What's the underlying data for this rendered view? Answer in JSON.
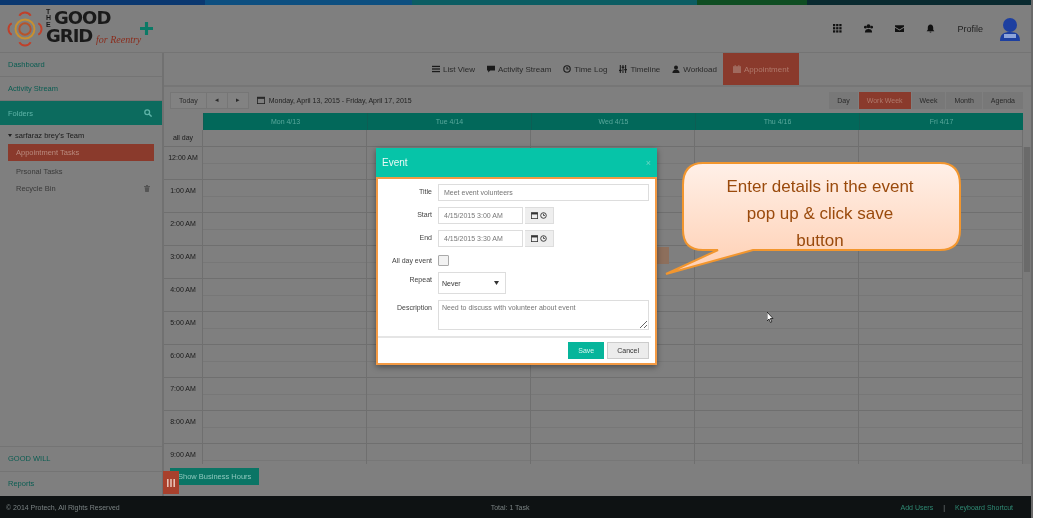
{
  "logo": {
    "small": "THE",
    "line1": "GOOD",
    "line2": "GRID",
    "tagline": "for Reentry"
  },
  "header": {
    "icons": [
      {
        "kind": "grid"
      },
      {
        "kind": "users"
      },
      {
        "kind": "mail"
      },
      {
        "kind": "bell"
      }
    ],
    "profile": "Profile"
  },
  "sidebar": {
    "top_items": [
      "Dashboard",
      "Activity Stream"
    ],
    "folders": {
      "label": "Folders"
    },
    "team": {
      "label": "sarfaraz brey's Team",
      "expanded": true,
      "children": [
        {
          "label": "Appointment Tasks",
          "selected": true,
          "trash": false
        },
        {
          "label": "Prsonal Tasks",
          "selected": false,
          "trash": false
        },
        {
          "label": "Recycle Bin",
          "selected": false,
          "trash": true
        }
      ]
    },
    "bottom_items": [
      "GOOD WILL",
      "Reports"
    ]
  },
  "nav_tabs": [
    {
      "label": "List View",
      "kind": "list",
      "selected": false
    },
    {
      "label": "Activity Stream",
      "kind": "comment",
      "selected": false
    },
    {
      "label": "Time Log",
      "kind": "clock",
      "selected": false
    },
    {
      "label": "Timeline",
      "kind": "sliders",
      "selected": false
    },
    {
      "label": "Workload",
      "kind": "user",
      "selected": false
    },
    {
      "label": "Appointment",
      "kind": "calendar",
      "selected": true
    }
  ],
  "toolbar": {
    "today": "Today",
    "prev": "◂",
    "next": "▸",
    "range": "Monday, April 13, 2015 - Friday, April 17, 2015",
    "views": [
      {
        "label": "Day",
        "selected": false
      },
      {
        "label": "Work Week",
        "selected": true
      },
      {
        "label": "Week",
        "selected": false
      },
      {
        "label": "Month",
        "selected": false
      },
      {
        "label": "Agenda",
        "selected": false
      }
    ]
  },
  "calendar": {
    "days": [
      "Mon 4/13",
      "Tue 4/14",
      "Wed 4/15",
      "Thu 4/16",
      "Fri 4/17"
    ],
    "all_day": "all day",
    "hours": [
      "12:00 AM",
      "1:00 AM",
      "2:00 AM",
      "3:00 AM",
      "4:00 AM",
      "5:00 AM",
      "6:00 AM",
      "7:00 AM",
      "8:00 AM",
      "9:00 AM"
    ],
    "show_hours_button": "Show Business Hours"
  },
  "dialog": {
    "title": "Event",
    "close": "×",
    "fields": [
      {
        "kind": "text",
        "label": "Title",
        "placeholder": "Meet event volunteers"
      },
      {
        "kind": "datetime",
        "label": "Start",
        "value": "4/15/2015 3:00 AM"
      },
      {
        "kind": "datetime",
        "label": "End",
        "value": "4/15/2015 3:30 AM"
      },
      {
        "kind": "checkbox",
        "label": "All day event",
        "checked": false
      },
      {
        "kind": "select",
        "label": "Repeat",
        "value": "Never"
      },
      {
        "kind": "textarea",
        "label": "Description",
        "placeholder": "Need to discuss with volunteer about event"
      }
    ],
    "buttons": [
      {
        "label": "Save",
        "kind": "primary"
      },
      {
        "label": "Cancel",
        "kind": "default"
      }
    ]
  },
  "callout": "Enter details in the event pop up & click save button",
  "footer": {
    "copyright": "© 2014 Protech, All Rights Reserved",
    "total": "Total: 1 Task",
    "links": [
      "Add Users",
      "Keyboard Shortcut"
    ],
    "separator": "|"
  }
}
